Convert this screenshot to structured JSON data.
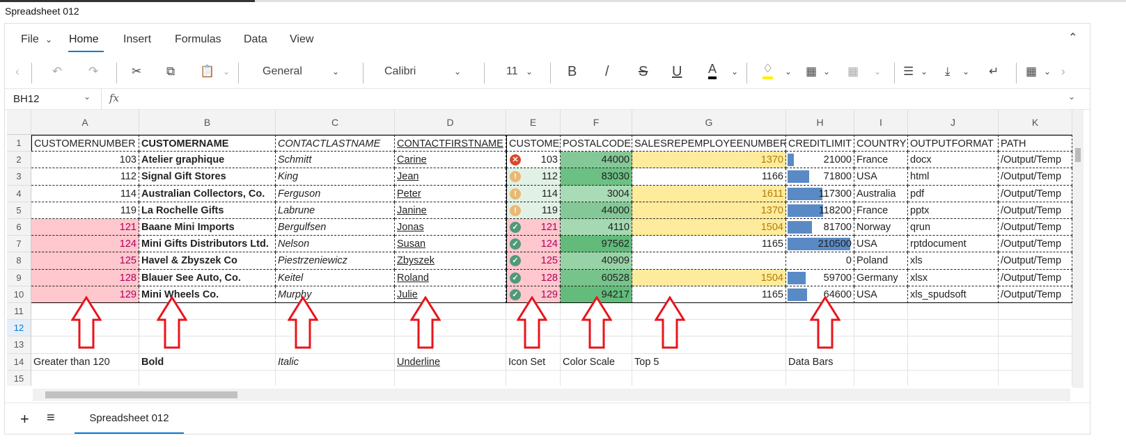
{
  "window": {
    "title": "Spreadsheet 012"
  },
  "menu": {
    "file": "File",
    "tabs": [
      "Home",
      "Insert",
      "Formulas",
      "Data",
      "View"
    ]
  },
  "toolbar": {
    "number_format": "General",
    "font": "Calibri",
    "font_size": "11",
    "bold": "B",
    "italic": "/",
    "strike": "S",
    "underline": "U",
    "font_color": "A"
  },
  "formula_bar": {
    "name_box": "BH12",
    "fx": "fx",
    "value": ""
  },
  "columns": [
    "A",
    "B",
    "C",
    "D",
    "E",
    "F",
    "G",
    "H",
    "I",
    "J",
    "K"
  ],
  "row_numbers": [
    "1",
    "2",
    "3",
    "4",
    "5",
    "6",
    "7",
    "8",
    "9",
    "10",
    "11",
    "12",
    "13",
    "14",
    "15"
  ],
  "rows": [
    [
      "CUSTOMERNUMBER",
      "CUSTOMERNAME",
      "CONTACTLASTNAME",
      "CONTACTFIRSTNAME",
      "CUSTOME",
      "POSTALCODE",
      "SALESREPEMPLOYEENUMBER",
      "CREDITLIMIT",
      "COUNTRY",
      "OUTPUTFORMAT",
      "PATH"
    ],
    [
      "103",
      "Atelier graphique",
      "Schmitt",
      "Carine",
      "103",
      "44000",
      "1370",
      "21000",
      "France",
      "docx",
      "/Output/Temp"
    ],
    [
      "112",
      "Signal Gift Stores",
      "King",
      "Jean",
      "112",
      "83030",
      "1166",
      "71800",
      "USA",
      "html",
      "/Output/Temp"
    ],
    [
      "114",
      "Australian Collectors, Co.",
      "Ferguson",
      "Peter",
      "114",
      "3004",
      "1611",
      "117300",
      "Australia",
      "pdf",
      "/Output/Temp"
    ],
    [
      "119",
      "La Rochelle Gifts",
      "Labrune",
      "Janine",
      "119",
      "44000",
      "1370",
      "118200",
      "France",
      "pptx",
      "/Output/Temp"
    ],
    [
      "121",
      "Baane Mini Imports",
      "Bergulfsen",
      "Jonas",
      "121",
      "4110",
      "1504",
      "81700",
      "Norway",
      "qrun",
      "/Output/Temp"
    ],
    [
      "124",
      "Mini Gifts Distributors Ltd.",
      "Nelson",
      "Susan",
      "124",
      "97562",
      "1165",
      "210500",
      "USA",
      "rptdocument",
      "/Output/Temp"
    ],
    [
      "125",
      "Havel & Zbyszek Co",
      "Piestrzeniewicz",
      "Zbyszek",
      "125",
      "40909",
      "",
      "0",
      "Poland",
      "xls",
      "/Output/Temp"
    ],
    [
      "128",
      "Blauer See Auto, Co.",
      "Keitel",
      "Roland",
      "128",
      "60528",
      "1504",
      "59700",
      "Germany",
      "xlsx",
      "/Output/Temp"
    ],
    [
      "129",
      "Mini Wheels Co.",
      "Murphy",
      "Julie",
      "129",
      "94217",
      "1165",
      "64600",
      "USA",
      "xls_spudsoft",
      "/Output/Temp"
    ]
  ],
  "labels_row14": [
    "Greater than 120",
    "Bold",
    "Italic",
    "Underline",
    "Icon Set",
    "Color Scale",
    "Top 5",
    "Data Bars",
    "",
    "",
    ""
  ],
  "conditional": {
    "highlight_fill": "#ffc7ce",
    "highlight_text": "#b0005e",
    "top5_fill": "#ffeb9c",
    "top5_text": "#b07c0a",
    "top5_rows": [
      1,
      3,
      4,
      5,
      8
    ],
    "icon_set": [
      "x",
      "warn",
      "warn",
      "warn",
      "check",
      "check",
      "check",
      "check",
      "check"
    ],
    "icon_colors": {
      "x": "#d9482b",
      "warn": "#e9b872",
      "check": "#4f9a78"
    },
    "e_green_fill": "#e2f1e5",
    "color_scale": [
      "#84c897",
      "#6cc083",
      "#a9dbb6",
      "#84c897",
      "#a5d9b2",
      "#62bb7a",
      "#97d3a6",
      "#76c38b",
      "#64bc7c"
    ],
    "data_bar_color": "#5a8ac6"
  },
  "sheet_tabs": {
    "active": "Spreadsheet 012",
    "add": "+",
    "list": "≡"
  }
}
